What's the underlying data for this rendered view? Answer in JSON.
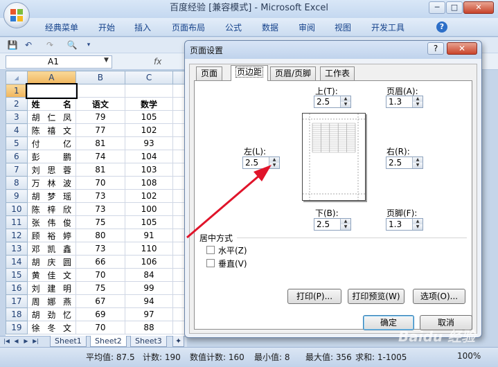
{
  "window": {
    "title": "百度经验  [兼容模式] - Microsoft Excel",
    "minimize": "─",
    "maximize": "□",
    "close": "✕"
  },
  "ribbon": {
    "tabs": [
      "经典菜单",
      "开始",
      "插入",
      "页面布局",
      "公式",
      "数据",
      "审阅",
      "视图",
      "开发工具"
    ],
    "help": "?"
  },
  "namebox": {
    "value": "A1"
  },
  "formula": {
    "fx": "fx"
  },
  "sheet": {
    "columns": [
      "A",
      "B",
      "C"
    ],
    "rows": [
      {
        "n": "1",
        "name": [
          "",
          ""
        ],
        "b": "",
        "c": ""
      },
      {
        "n": "2",
        "name": [
          "姓",
          "名"
        ],
        "b": "语文",
        "c": "数学"
      },
      {
        "n": "3",
        "name": [
          "胡",
          "仁",
          "凤"
        ],
        "b": "79",
        "c": "105"
      },
      {
        "n": "4",
        "name": [
          "陈",
          "禧",
          "文"
        ],
        "b": "77",
        "c": "102"
      },
      {
        "n": "5",
        "name": [
          "付",
          "亿"
        ],
        "b": "81",
        "c": "93"
      },
      {
        "n": "6",
        "name": [
          "彭",
          "鹏"
        ],
        "b": "74",
        "c": "104"
      },
      {
        "n": "7",
        "name": [
          "刘",
          "思",
          "蓉"
        ],
        "b": "81",
        "c": "103"
      },
      {
        "n": "8",
        "name": [
          "万",
          "林",
          "波"
        ],
        "b": "70",
        "c": "108"
      },
      {
        "n": "9",
        "name": [
          "胡",
          "梦",
          "瑶"
        ],
        "b": "73",
        "c": "102"
      },
      {
        "n": "10",
        "name": [
          "陈",
          "梓",
          "欣"
        ],
        "b": "73",
        "c": "100"
      },
      {
        "n": "11",
        "name": [
          "张",
          "伟",
          "俊"
        ],
        "b": "75",
        "c": "105"
      },
      {
        "n": "12",
        "name": [
          "顾",
          "裕",
          "婷"
        ],
        "b": "80",
        "c": "91"
      },
      {
        "n": "13",
        "name": [
          "邓",
          "凯",
          "鑫"
        ],
        "b": "73",
        "c": "110"
      },
      {
        "n": "14",
        "name": [
          "胡",
          "庆",
          "圆"
        ],
        "b": "66",
        "c": "106"
      },
      {
        "n": "15",
        "name": [
          "黄",
          "佳",
          "文"
        ],
        "b": "70",
        "c": "84"
      },
      {
        "n": "16",
        "name": [
          "刘",
          "建",
          "明"
        ],
        "b": "75",
        "c": "99"
      },
      {
        "n": "17",
        "name": [
          "周",
          "娜",
          "燕"
        ],
        "b": "67",
        "c": "94"
      },
      {
        "n": "18",
        "name": [
          "胡",
          "劲",
          "忆"
        ],
        "b": "69",
        "c": "97"
      },
      {
        "n": "19",
        "name": [
          "徐",
          "冬",
          "文"
        ],
        "b": "70",
        "c": "88"
      }
    ],
    "tabs": [
      "Sheet1",
      "Sheet2",
      "Sheet3"
    ]
  },
  "status": {
    "avg": "平均值: 87.5",
    "count": "计数: 190",
    "numcount": "数值计数: 160",
    "min": "最小值: 8",
    "max": "最大值: 356",
    "sum": "求和: 1-1005",
    "zoom": "100%"
  },
  "dialog": {
    "title": "页面设置",
    "help": "?",
    "close": "✕",
    "tabs": [
      "页面",
      "页边距",
      "页眉/页脚",
      "工作表"
    ],
    "top_label": "上(T):",
    "top_value": "2.5",
    "header_label": "页眉(A):",
    "header_value": "1.3",
    "left_label": "左(L):",
    "left_value": "2.5",
    "right_label": "右(R):",
    "right_value": "2.5",
    "bottom_label": "下(B):",
    "bottom_value": "2.5",
    "footer_label": "页脚(F):",
    "footer_value": "1.3",
    "center_group": "居中方式",
    "horizontal": "水平(Z)",
    "vertical": "垂直(V)",
    "print_btn": "打印(P)...",
    "preview_btn": "打印预览(W)",
    "options_btn": "选项(O)...",
    "ok_btn": "确定",
    "cancel_btn": "取消"
  },
  "watermark": "Baidu 经验",
  "colors": {
    "accent": "#15428b",
    "arrow": "#e0142a"
  }
}
